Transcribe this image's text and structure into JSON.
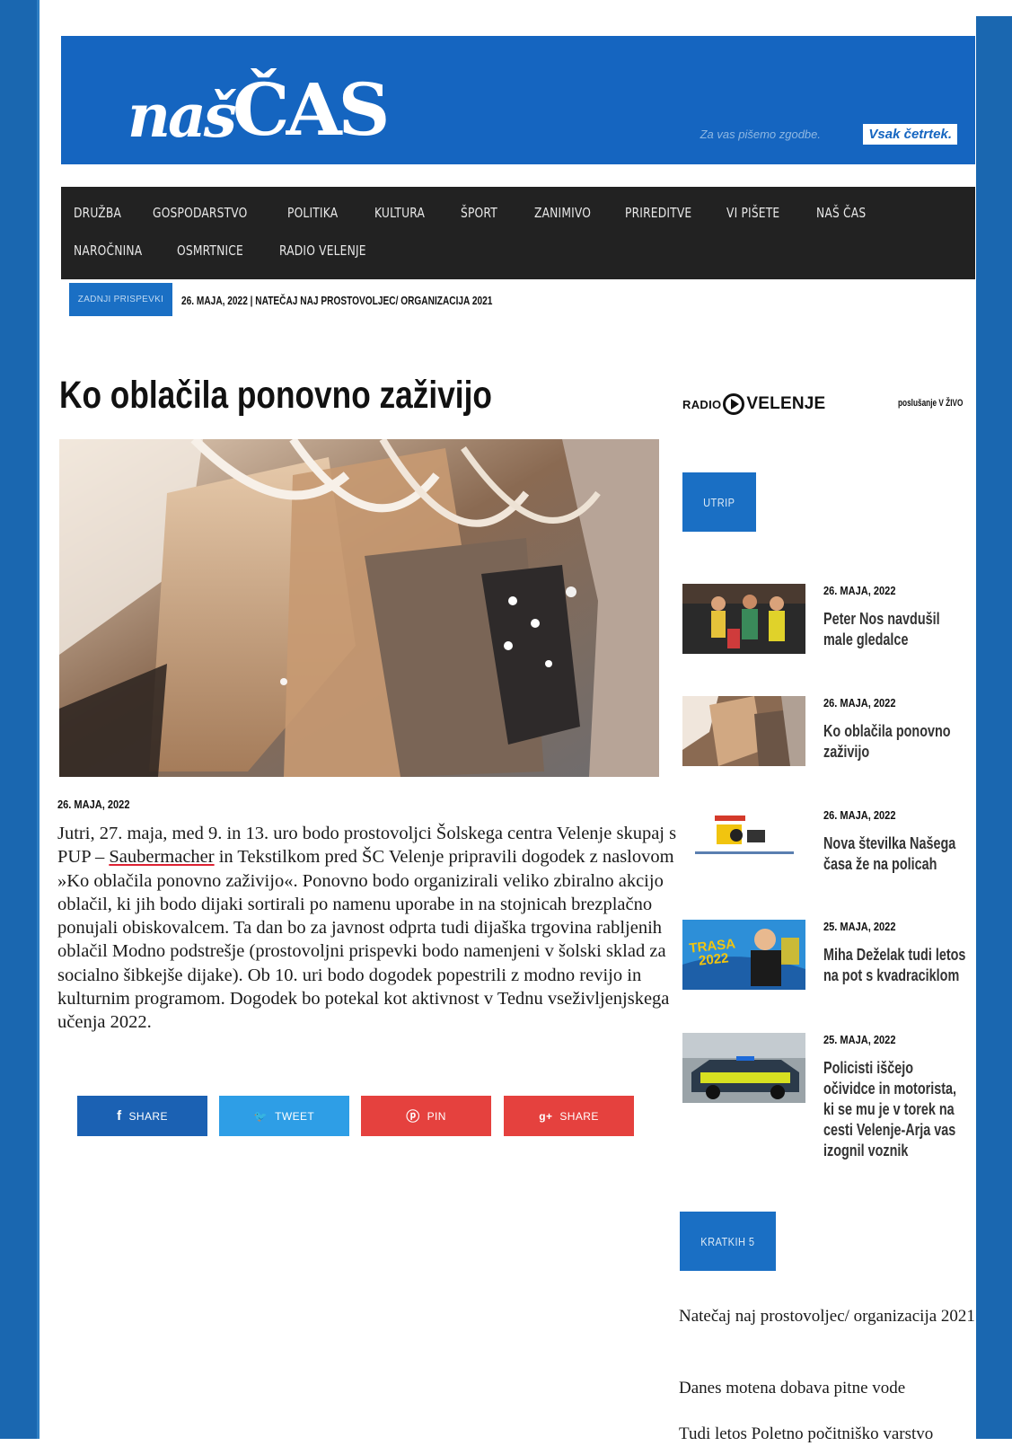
{
  "header": {
    "logo_part1": "naš",
    "logo_part2": "ČAS",
    "tagline": "Za vas pišemo zgodbe.",
    "tagline_badge": "Vsak četrtek."
  },
  "nav": {
    "items": [
      "DRUŽBA",
      "GOSPODARSTVO",
      "POLITIKA",
      "KULTURA",
      "ŠPORT",
      "ZANIMIVO",
      "PRIREDITVE",
      "VI PIŠETE",
      "NAŠ ČAS",
      "NAROČNINA",
      "OSMRTNICE",
      "RADIO VELENJE"
    ]
  },
  "breaking": {
    "label": "ZADNJI PRISPEVKI",
    "text": "26. MAJA, 2022 | NATEČAJ NAJ PROSTOVOLJEC/ ORGANIZACIJA 2021"
  },
  "article": {
    "title": "Ko oblačila ponovno zaživijo",
    "date": "26. MAJA, 2022",
    "body_before_link": "Jutri, 27. maja, med 9. in 13. uro bodo prostovoljci Šolskega centra Velenje skupaj s PUP – ",
    "body_link": "Saubermacher",
    "body_after_link": " in Tekstilkom pred ŠC Velenje pripravili dogodek z naslovom »Ko oblačila ponovno zaživijo«. Ponovno bodo organizirali veliko zbiralno akcijo oblačil, ki jih bodo dijaki sortirali po namenu uporabe in na stojnicah brezplačno ponujali obiskovalcem. Ta dan bo za javnost odprta tudi dijaška trgovina rabljenih oblačil Modno podstrešje (prostovoljni prispevki bodo namenjeni v šolski sklad za socialno šibkejše dijake). Ob 10. uri bodo dogodek popestrili z modno revijo in kulturnim programom. Dogodek bo potekal kot aktivnost v Tednu vseživljenjskega učenja 2022."
  },
  "share": [
    {
      "label": "SHARE",
      "icon": "f",
      "color": "#1b61b3"
    },
    {
      "label": "TWEET",
      "icon": "🐦",
      "color": "#2e9ee6"
    },
    {
      "label": "PIN",
      "icon": "ⓟ",
      "color": "#e5413e"
    },
    {
      "label": "SHARE",
      "icon": "g+",
      "color": "#e5413e"
    }
  ],
  "sidebar": {
    "radio_word": "RADIO",
    "radio_name": "VELENJE",
    "live": "poslušanje V ŽIVO",
    "utrip_label": "UTRIP",
    "posts": [
      {
        "date": "26. MAJA, 2022",
        "title": "Peter Nos navdušil male gledalce"
      },
      {
        "date": "26. MAJA, 2022",
        "title": "Ko oblačila ponovno zaživijo"
      },
      {
        "date": "26. MAJA, 2022",
        "title": "Nova številka Našega časa že na policah"
      },
      {
        "date": "25. MAJA, 2022",
        "title": "Miha Deželak tudi letos na pot s kvadraciklom"
      },
      {
        "date": "25. MAJA, 2022",
        "title": "Policisti iščejo očividce in motorista, ki se mu je v torek na cesti Velenje-Arja vas izognil voznik"
      }
    ],
    "kratkih_label": "KRATKIH 5",
    "kratkih_items": [
      "Natečaj naj prostovoljec/ organizacija 2021",
      "Danes motena dobava pitne vode",
      "Tudi letos Poletno počitniško varstvo"
    ],
    "trasa_badge": "TRASA 2022"
  }
}
